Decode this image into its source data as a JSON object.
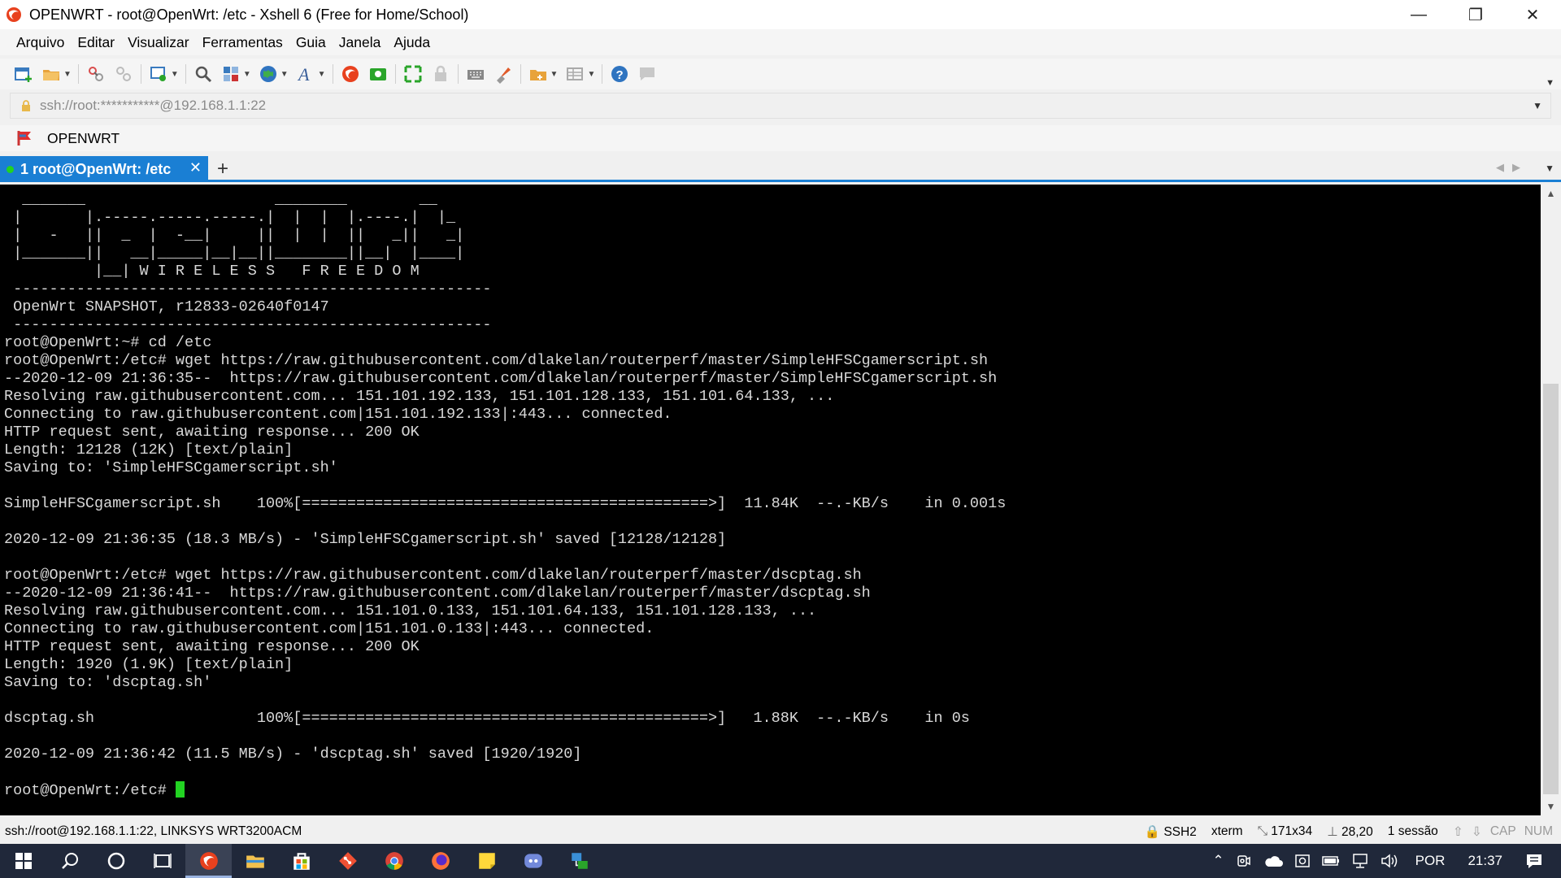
{
  "window": {
    "title": "OPENWRT - root@OpenWrt: /etc - Xshell 6 (Free for Home/School)",
    "controls": {
      "minimize": "—",
      "restore": "❐",
      "close": "✕"
    }
  },
  "menu": [
    "Arquivo",
    "Editar",
    "Visualizar",
    "Ferramentas",
    "Guia",
    "Janela",
    "Ajuda"
  ],
  "address": {
    "value": "ssh://root:***********@192.168.1.1:22"
  },
  "sessions_bar": {
    "label": "OPENWRT"
  },
  "tab": {
    "number": "1",
    "label": "1 root@OpenWrt: /etc",
    "close": "✕",
    "new": "+"
  },
  "terminal": {
    "lines": [
      "  _______                     ________        __",
      " |       |.-----.-----.-----.|  |  |  |.----.|  |_",
      " |   -   ||  _  |  -__|     ||  |  |  ||   _||   _|",
      " |_______||   __|_____|__|__||________||__|  |____|",
      "          |__| W I R E L E S S   F R E E D O M",
      " -----------------------------------------------------",
      " OpenWrt SNAPSHOT, r12833-02640f0147",
      " -----------------------------------------------------",
      "root@OpenWrt:~# cd /etc",
      "root@OpenWrt:/etc# wget https://raw.githubusercontent.com/dlakelan/routerperf/master/SimpleHFSCgamerscript.sh",
      "--2020-12-09 21:36:35--  https://raw.githubusercontent.com/dlakelan/routerperf/master/SimpleHFSCgamerscript.sh",
      "Resolving raw.githubusercontent.com... 151.101.192.133, 151.101.128.133, 151.101.64.133, ...",
      "Connecting to raw.githubusercontent.com|151.101.192.133|:443... connected.",
      "HTTP request sent, awaiting response... 200 OK",
      "Length: 12128 (12K) [text/plain]",
      "Saving to: 'SimpleHFSCgamerscript.sh'",
      "",
      "SimpleHFSCgamerscript.sh    100%[=============================================>]  11.84K  --.-KB/s    in 0.001s",
      "",
      "2020-12-09 21:36:35 (18.3 MB/s) - 'SimpleHFSCgamerscript.sh' saved [12128/12128]",
      "",
      "root@OpenWrt:/etc# wget https://raw.githubusercontent.com/dlakelan/routerperf/master/dscptag.sh",
      "--2020-12-09 21:36:41--  https://raw.githubusercontent.com/dlakelan/routerperf/master/dscptag.sh",
      "Resolving raw.githubusercontent.com... 151.101.0.133, 151.101.64.133, 151.101.128.133, ...",
      "Connecting to raw.githubusercontent.com|151.101.0.133|:443... connected.",
      "HTTP request sent, awaiting response... 200 OK",
      "Length: 1920 (1.9K) [text/plain]",
      "Saving to: 'dscptag.sh'",
      "",
      "dscptag.sh                  100%[=============================================>]   1.88K  --.-KB/s    in 0s",
      "",
      "2020-12-09 21:36:42 (11.5 MB/s) - 'dscptag.sh' saved [1920/1920]",
      ""
    ],
    "prompt": "root@OpenWrt:/etc# "
  },
  "statusbar": {
    "connection": "ssh://root@192.168.1.1:22, LINKSYS WRT3200ACM",
    "protocol": "SSH2",
    "terminal_type": "xterm",
    "size": "171x34",
    "cursor_pos": "28,20",
    "sessions": "1 sessão",
    "cap": "CAP",
    "num": "NUM"
  },
  "taskbar": {
    "lang": "POR",
    "time": "21:37"
  },
  "colors": {
    "accent": "#1a7fd4",
    "terminal_bg": "#000000",
    "terminal_fg": "#d8d8d8",
    "cursor": "#22d322",
    "taskbar": "#20283a"
  }
}
